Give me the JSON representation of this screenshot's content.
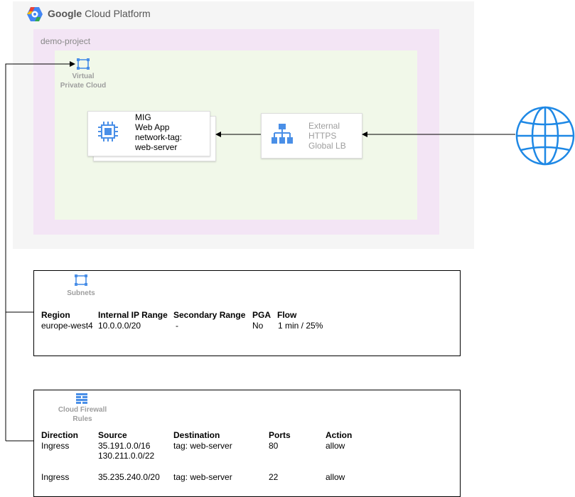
{
  "platform": {
    "title_bold": "Google",
    "title_rest": " Cloud Platform"
  },
  "project": {
    "label": "demo-project"
  },
  "vpc": {
    "label_line1": "Virtual",
    "label_line2": "Private Cloud"
  },
  "mig": {
    "lines": [
      "MIG",
      "Web App",
      "network-tag:",
      "web-server"
    ]
  },
  "lb": {
    "lines": [
      "External",
      "HTTPS",
      "Global LB"
    ]
  },
  "subnets": {
    "label": "Subnets",
    "headers": [
      "Region",
      "Internal IP Range",
      "Secondary Range",
      "PGA",
      "Flow"
    ],
    "rows": [
      [
        "europe-west4",
        "10.0.0.0/20",
        "-",
        "No",
        "1 min / 25%"
      ]
    ]
  },
  "firewall": {
    "label_line1": "Cloud Firewall",
    "label_line2": "Rules",
    "headers": [
      "Direction",
      "Source",
      "Destination",
      "Ports",
      "Action"
    ],
    "rows": [
      {
        "direction": "Ingress",
        "source": [
          "35.191.0.0/16",
          "130.211.0.0/22"
        ],
        "destination": "tag: web-server",
        "ports": "80",
        "action": "allow"
      },
      {
        "direction": "Ingress",
        "source": [
          "35.235.240.0/20"
        ],
        "destination": "tag: web-server",
        "ports": "22",
        "action": "allow"
      }
    ]
  },
  "colors": {
    "gcp_blue": "#4285f4",
    "globe_blue": "#1e88e5",
    "icon_blue": "#4a8fe7"
  },
  "icons": [
    "gcp-logo-icon",
    "vpc-icon",
    "compute-engine-icon",
    "load-balancer-icon",
    "internet-globe-icon",
    "subnets-icon",
    "firewall-icon"
  ]
}
